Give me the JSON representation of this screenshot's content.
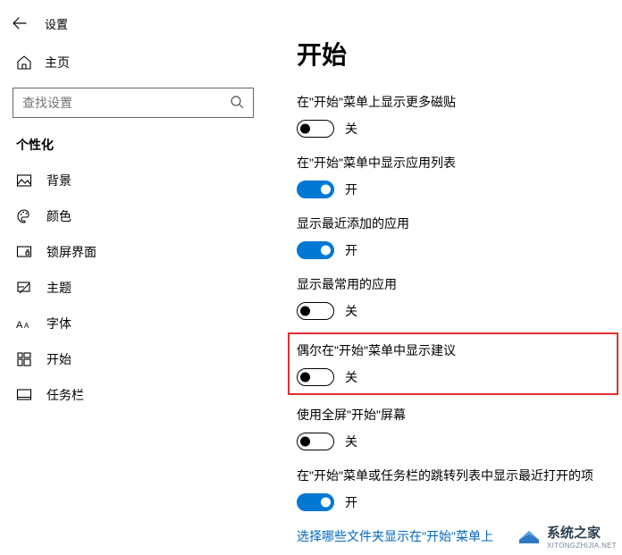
{
  "window": {
    "title": "设置"
  },
  "sidebar": {
    "home_label": "主页",
    "search_placeholder": "查找设置",
    "section_header": "个性化",
    "items": [
      {
        "label": "背景"
      },
      {
        "label": "颜色"
      },
      {
        "label": "锁屏界面"
      },
      {
        "label": "主题"
      },
      {
        "label": "字体"
      },
      {
        "label": "开始"
      },
      {
        "label": "任务栏"
      }
    ]
  },
  "main": {
    "page_title": "开始",
    "settings": [
      {
        "label": "在\"开始\"菜单上显示更多磁贴",
        "on": false,
        "state_text": "关",
        "highlight": false
      },
      {
        "label": "在\"开始\"菜单中显示应用列表",
        "on": true,
        "state_text": "开",
        "highlight": false
      },
      {
        "label": "显示最近添加的应用",
        "on": true,
        "state_text": "开",
        "highlight": false
      },
      {
        "label": "显示最常用的应用",
        "on": false,
        "state_text": "关",
        "highlight": false
      },
      {
        "label": "偶尔在\"开始\"菜单中显示建议",
        "on": false,
        "state_text": "关",
        "highlight": true
      },
      {
        "label": "使用全屏\"开始\"屏幕",
        "on": false,
        "state_text": "关",
        "highlight": false
      },
      {
        "label": "在\"开始\"菜单或任务栏的跳转列表中显示最近打开的项",
        "on": true,
        "state_text": "开",
        "highlight": false
      }
    ],
    "link_text": "选择哪些文件夹显示在\"开始\"菜单上"
  },
  "watermark": {
    "name": "系统之家",
    "sub": "XITONGZHIJIA.NET"
  }
}
